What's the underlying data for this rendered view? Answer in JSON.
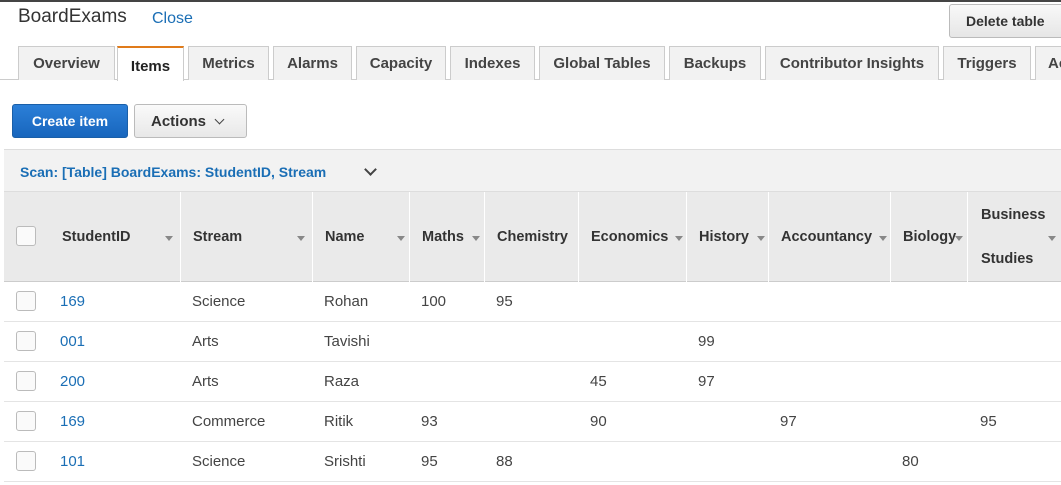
{
  "header": {
    "title": "BoardExams",
    "close_label": "Close",
    "delete_label": "Delete table"
  },
  "tabs": [
    "Overview",
    "Items",
    "Metrics",
    "Alarms",
    "Capacity",
    "Indexes",
    "Global Tables",
    "Backups",
    "Contributor Insights",
    "Triggers",
    "Ac"
  ],
  "active_tab": "Items",
  "toolbar": {
    "create_label": "Create item",
    "actions_label": "Actions"
  },
  "scan": {
    "label": "Scan: [Table] BoardExams: StudentID, Stream"
  },
  "columns": {
    "studentid": "StudentID",
    "stream": "Stream",
    "name": "Name",
    "maths": "Maths",
    "chemistry": "Chemistry",
    "economics": "Economics",
    "history": "History",
    "accountancy": "Accountancy",
    "biology": "Biology",
    "business_line1": "Business",
    "business_line2": "Studies"
  },
  "rows": [
    {
      "studentid": "169",
      "stream": "Science",
      "name": "Rohan",
      "maths": "100",
      "chemistry": "95",
      "economics": "",
      "history": "",
      "accountancy": "",
      "biology": "",
      "business": ""
    },
    {
      "studentid": "001",
      "stream": "Arts",
      "name": "Tavishi",
      "maths": "",
      "chemistry": "",
      "economics": "",
      "history": "99",
      "accountancy": "",
      "biology": "",
      "business": ""
    },
    {
      "studentid": "200",
      "stream": "Arts",
      "name": "Raza",
      "maths": "",
      "chemistry": "",
      "economics": "45",
      "history": "97",
      "accountancy": "",
      "biology": "",
      "business": ""
    },
    {
      "studentid": "169",
      "stream": "Commerce",
      "name": "Ritik",
      "maths": "93",
      "chemistry": "",
      "economics": "90",
      "history": "",
      "accountancy": "97",
      "biology": "",
      "business": "95"
    },
    {
      "studentid": "101",
      "stream": "Science",
      "name": "Srishti",
      "maths": "95",
      "chemistry": "88",
      "economics": "",
      "history": "",
      "accountancy": "",
      "biology": "80",
      "business": ""
    }
  ]
}
